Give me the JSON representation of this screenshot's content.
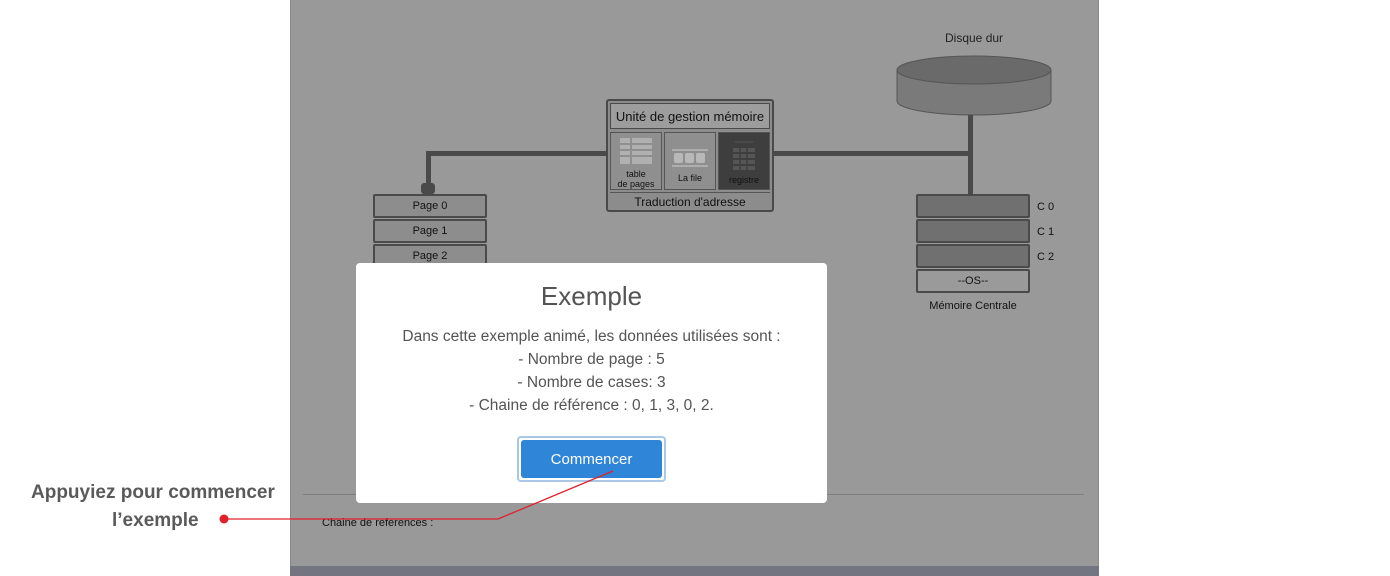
{
  "diagram": {
    "disk_label": "Disque dur",
    "mmu": {
      "title": "Unité de gestion mémoire",
      "cells": [
        {
          "label_line1": "table",
          "label_line2": "de pages",
          "icon": "table-icon"
        },
        {
          "label_line1": "La file",
          "label_line2": "",
          "icon": "queue-icon"
        },
        {
          "label_line1": "registre",
          "label_line2": "",
          "icon": "register-icon"
        }
      ],
      "footer": "Traduction d'adresse"
    },
    "pages": [
      "Page 0",
      "Page 1",
      "Page 2"
    ],
    "memory": {
      "frames": [
        "C 0",
        "C 1",
        "C 2"
      ],
      "os_label": "--OS--",
      "caption": "Mémoire Centrale"
    },
    "reference_chain_label": "Chaine de references :"
  },
  "modal": {
    "title": "Exemple",
    "lines": [
      "Dans cette exemple animé, les données utilisées sont :",
      "- Nombre de page : 5",
      "- Nombre de cases: 3",
      "- Chaine de référence : 0, 1, 3, 0, 2."
    ],
    "button_label": "Commencer"
  },
  "annotation": {
    "line1": "Appuyiez pour commencer",
    "line2": "l’exemple",
    "color": "#e0202a"
  },
  "colors": {
    "overlay": "#999999",
    "button": "#2f86d8",
    "wire": "#4a4a4a"
  }
}
